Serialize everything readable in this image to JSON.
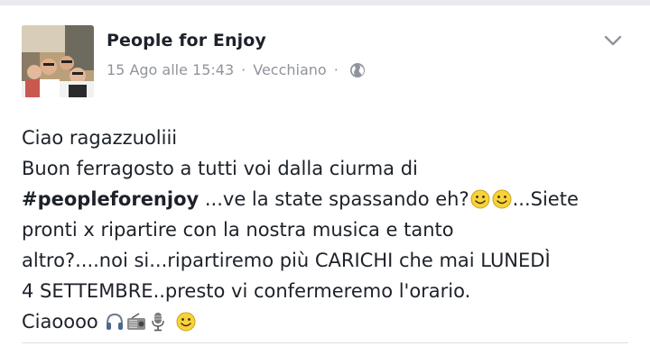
{
  "post": {
    "author": "People for Enjoy",
    "date": "15 Ago alle 15:43",
    "separator": "·",
    "location": "Vecchiano",
    "icons": {
      "privacy": "globe-icon",
      "menu": "chevron-down-icon",
      "avatar": "profile-photo"
    },
    "text": {
      "line1": "Ciao ragazzuoliii",
      "line2": "Buon ferragosto a tutti voi dalla ciurma di",
      "hashtag": "#peopleforenjoy",
      "line3_after_hashtag": " ...ve la state spassando eh?",
      "line3_tail": "...Siete",
      "line4": "pronti x ripartire con la nostra musica e tanto",
      "line5": "altro?....noi si...ripartiremo più CARICHI che mai LUNEDÌ",
      "line6": "4 SETTEMBRE..presto vi confermeremo l'orario.",
      "line7": "Ciaoooo "
    },
    "emojis": [
      "smiley-icon",
      "smiley-icon",
      "headphones-icon",
      "radio-icon",
      "microphone-icon",
      "smiley-icon"
    ]
  },
  "colors": {
    "text": "#1d2129",
    "meta": "#90949c",
    "emoji_face": "#f7d23a"
  }
}
